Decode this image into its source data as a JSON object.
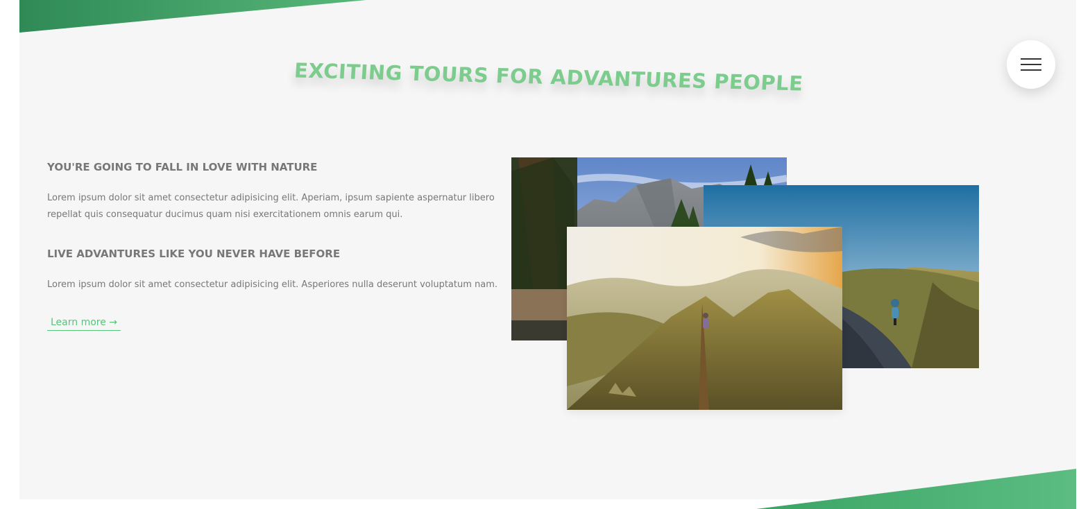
{
  "section": {
    "title": "EXCITING TOURS FOR ADVANTURES PEOPLE",
    "feature_1": {
      "heading": "YOU'RE GOING TO FALL IN LOVE WITH NATURE",
      "body": "Lorem ipsum dolor sit amet consectetur adipisicing elit. Aperiam, ipsum sapiente aspernatur libero repellat quis consequatur ducimus quam nisi exercitationem omnis earum qui."
    },
    "feature_2": {
      "heading": "LIVE ADVANTURES LIKE YOU NEVER HAVE BEFORE",
      "body": "Lorem ipsum dolor sit amet consectetur adipisicing elit. Asperiores nulla deserunt voluptatum nam."
    },
    "link_label": "Learn more →"
  },
  "navigation": {
    "menu_icon": "hamburger-icon"
  },
  "photos": [
    {
      "scene": "forest-cliffs"
    },
    {
      "scene": "cyclist-road"
    },
    {
      "scene": "hiker-ridge"
    }
  ],
  "colors": {
    "accent": "#55c57a",
    "accent_light": "#7ed56f",
    "heading_gradient_start": "#7ed56f",
    "heading_gradient_end": "#55c57a",
    "text": "#777777",
    "section_bg": "#f6f6f6",
    "page_bg": "#ffffff"
  }
}
